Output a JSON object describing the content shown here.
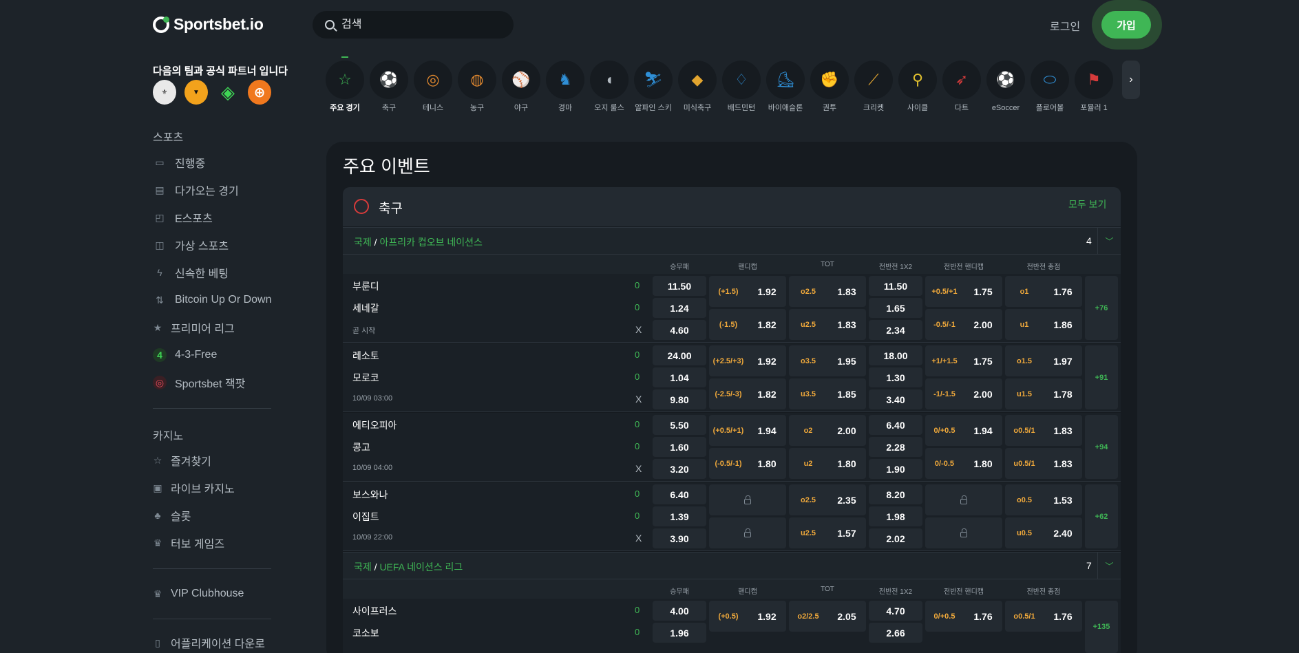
{
  "header": {
    "logo_text": "Sportsbet.io",
    "search_placeholder": "검색",
    "login_label": "로그인",
    "signup_label": "가입"
  },
  "sidebar": {
    "partner_title": "다음의 팀과 공식 파트너 입니다",
    "sports_title": "스포츠",
    "sports_items": [
      "진행중",
      "다가오는 경기",
      "E스포츠",
      "가상 스포츠",
      "신속한 베팅",
      "Bitcoin Up Or Down",
      "프리미어 리그",
      "4-3-Free",
      "Sportsbet 잭팟"
    ],
    "casino_title": "카지노",
    "casino_items": [
      "즐겨찾기",
      "라이브 카지노",
      "슬롯",
      "터보 게임즈"
    ],
    "vip_label": "VIP Clubhouse",
    "app_label": "어플리케이션 다운로"
  },
  "sports_tabs": [
    {
      "label": "주요 경기",
      "icon": "☆",
      "color": "#3fb655"
    },
    {
      "label": "축구",
      "icon": "⚽",
      "color": "#d63b3b"
    },
    {
      "label": "테니스",
      "icon": "◎",
      "color": "#e2892f"
    },
    {
      "label": "농구",
      "icon": "◍",
      "color": "#e2892f"
    },
    {
      "label": "야구",
      "icon": "⚾",
      "color": "#7f8a94"
    },
    {
      "label": "경마",
      "icon": "♞",
      "color": "#2f8fd6"
    },
    {
      "label": "오지 룰스",
      "icon": "◖",
      "color": "#b3bbc2"
    },
    {
      "label": "알파인 스키",
      "icon": "⛷",
      "color": "#2f8fd6"
    },
    {
      "label": "미식축구",
      "icon": "◆",
      "color": "#e2a52f"
    },
    {
      "label": "배드민턴",
      "icon": "♢",
      "color": "#2f8fd6"
    },
    {
      "label": "바이애슬론",
      "icon": "⛸",
      "color": "#2f8fd6"
    },
    {
      "label": "권투",
      "icon": "✊",
      "color": "#d63b3b"
    },
    {
      "label": "크리켓",
      "icon": "⟋",
      "color": "#e2a52f"
    },
    {
      "label": "사이클",
      "icon": "⚲",
      "color": "#e2c12f"
    },
    {
      "label": "다트",
      "icon": "➶",
      "color": "#d63b3b"
    },
    {
      "label": "eSoccer",
      "icon": "⚽",
      "color": "#d63b3b"
    },
    {
      "label": "플로어볼",
      "icon": "⬭",
      "color": "#2f8fd6"
    },
    {
      "label": "포뮬러 1",
      "icon": "⚑",
      "color": "#d63b3b"
    }
  ],
  "main": {
    "title": "주요 이벤트",
    "section_name": "축구",
    "see_all": "모두 보기",
    "columns": [
      "승무패",
      "핸디캡",
      "TOT",
      "전반전 1X2",
      "전반전 핸디캡",
      "전반전 총점"
    ],
    "leagues": [
      {
        "region": "국제",
        "name": "아프리카 컵오브 네이션스",
        "count": "4",
        "matches": [
          {
            "home": "부룬디",
            "away": "세네갈",
            "time": "곧 시작",
            "score_home": "0",
            "score_away": "0",
            "x": "X",
            "odds": [
              "11.50",
              "1.24",
              "4.60"
            ],
            "hcp": [
              [
                "(+1.5)",
                "1.92"
              ],
              [
                "(-1.5)",
                "1.82"
              ]
            ],
            "tot": [
              [
                "o2.5",
                "1.83"
              ],
              [
                "u2.5",
                "1.83"
              ]
            ],
            "ht": [
              "11.50",
              "1.65",
              "2.34"
            ],
            "hthcp": [
              [
                "+0.5/+1",
                "1.75"
              ],
              [
                "-0.5/-1",
                "2.00"
              ]
            ],
            "httot": [
              [
                "o1",
                "1.76"
              ],
              [
                "u1",
                "1.86"
              ]
            ],
            "more": "+76"
          },
          {
            "home": "레소토",
            "away": "모로코",
            "time": "10/09 03:00",
            "score_home": "0",
            "score_away": "0",
            "x": "X",
            "odds": [
              "24.00",
              "1.04",
              "9.80"
            ],
            "hcp": [
              [
                "(+2.5/+3)",
                "1.92"
              ],
              [
                "(-2.5/-3)",
                "1.82"
              ]
            ],
            "tot": [
              [
                "o3.5",
                "1.95"
              ],
              [
                "u3.5",
                "1.85"
              ]
            ],
            "ht": [
              "18.00",
              "1.30",
              "3.40"
            ],
            "hthcp": [
              [
                "+1/+1.5",
                "1.75"
              ],
              [
                "-1/-1.5",
                "2.00"
              ]
            ],
            "httot": [
              [
                "o1.5",
                "1.97"
              ],
              [
                "u1.5",
                "1.78"
              ]
            ],
            "more": "+91"
          },
          {
            "home": "에티오피아",
            "away": "콩고",
            "time": "10/09 04:00",
            "score_home": "0",
            "score_away": "0",
            "x": "X",
            "odds": [
              "5.50",
              "1.60",
              "3.20"
            ],
            "hcp": [
              [
                "(+0.5/+1)",
                "1.94"
              ],
              [
                "(-0.5/-1)",
                "1.80"
              ]
            ],
            "tot": [
              [
                "o2",
                "2.00"
              ],
              [
                "u2",
                "1.80"
              ]
            ],
            "ht": [
              "6.40",
              "2.28",
              "1.90"
            ],
            "hthcp": [
              [
                "0/+0.5",
                "1.94"
              ],
              [
                "0/-0.5",
                "1.80"
              ]
            ],
            "httot": [
              [
                "o0.5/1",
                "1.83"
              ],
              [
                "u0.5/1",
                "1.83"
              ]
            ],
            "more": "+94"
          },
          {
            "home": "보스와나",
            "away": "이집트",
            "time": "10/09 22:00",
            "score_home": "0",
            "score_away": "0",
            "x": "X",
            "odds": [
              "6.40",
              "1.39",
              "3.90"
            ],
            "hcp": null,
            "tot": [
              [
                "o2.5",
                "2.35"
              ],
              [
                "u2.5",
                "1.57"
              ]
            ],
            "ht": [
              "8.20",
              "1.98",
              "2.02"
            ],
            "hthcp": null,
            "httot": [
              [
                "o0.5",
                "1.53"
              ],
              [
                "u0.5",
                "2.40"
              ]
            ],
            "more": "+62"
          }
        ]
      },
      {
        "region": "국제",
        "name": "UEFA 네이션스 리그",
        "count": "7",
        "matches": [
          {
            "home": "사이프러스",
            "away": "코소보",
            "score_home": "0",
            "score_away": "0",
            "odds": [
              "4.00",
              "1.96"
            ],
            "hcp": [
              [
                "(+0.5)",
                "1.92"
              ]
            ],
            "tot": [
              [
                "o2/2.5",
                "2.05"
              ]
            ],
            "ht": [
              "4.70",
              "2.66"
            ],
            "hthcp": [
              [
                "0/+0.5",
                "1.76"
              ]
            ],
            "httot": [
              [
                "o0.5/1",
                "1.76"
              ]
            ],
            "more": "+135"
          }
        ]
      }
    ]
  }
}
